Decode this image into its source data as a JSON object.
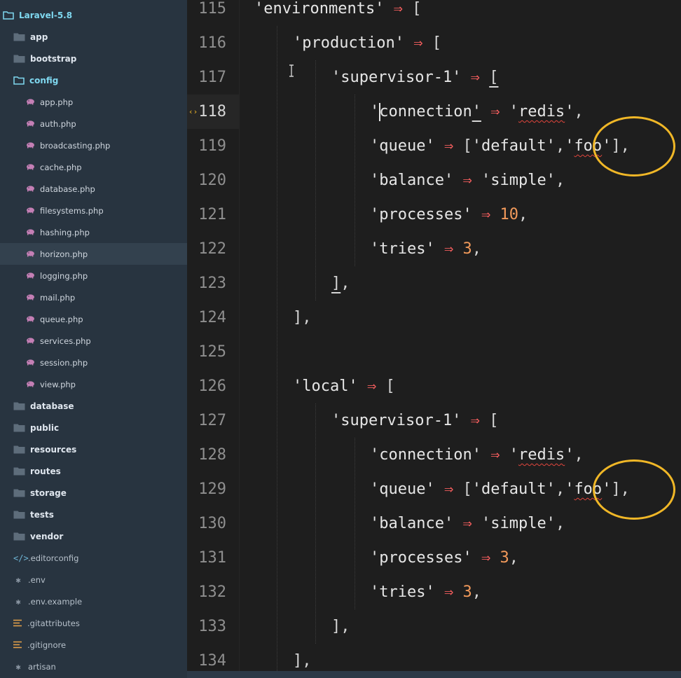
{
  "sidebar": {
    "root": {
      "label": "Laravel-5.8"
    },
    "items": [
      {
        "label": "app",
        "kind": "folder"
      },
      {
        "label": "bootstrap",
        "kind": "folder"
      },
      {
        "label": "config",
        "kind": "folder-open"
      },
      {
        "label": "app.php",
        "kind": "php"
      },
      {
        "label": "auth.php",
        "kind": "php"
      },
      {
        "label": "broadcasting.php",
        "kind": "php"
      },
      {
        "label": "cache.php",
        "kind": "php"
      },
      {
        "label": "database.php",
        "kind": "php"
      },
      {
        "label": "filesystems.php",
        "kind": "php"
      },
      {
        "label": "hashing.php",
        "kind": "php"
      },
      {
        "label": "horizon.php",
        "kind": "php",
        "selected": true
      },
      {
        "label": "logging.php",
        "kind": "php"
      },
      {
        "label": "mail.php",
        "kind": "php"
      },
      {
        "label": "queue.php",
        "kind": "php"
      },
      {
        "label": "services.php",
        "kind": "php"
      },
      {
        "label": "session.php",
        "kind": "php"
      },
      {
        "label": "view.php",
        "kind": "php"
      },
      {
        "label": "database",
        "kind": "folder"
      },
      {
        "label": "public",
        "kind": "folder"
      },
      {
        "label": "resources",
        "kind": "folder"
      },
      {
        "label": "routes",
        "kind": "folder"
      },
      {
        "label": "storage",
        "kind": "folder"
      },
      {
        "label": "tests",
        "kind": "folder"
      },
      {
        "label": "vendor",
        "kind": "folder"
      },
      {
        "label": ".editorconfig",
        "kind": "code-file"
      },
      {
        "label": ".env",
        "kind": "star-file"
      },
      {
        "label": ".env.example",
        "kind": "star-file"
      },
      {
        "label": ".gitattributes",
        "kind": "lines-file"
      },
      {
        "label": ".gitignore",
        "kind": "lines-file"
      },
      {
        "label": "artisan",
        "kind": "star-file"
      }
    ]
  },
  "editor": {
    "current_line": "118",
    "lines": [
      {
        "n": "115",
        "indent": 2,
        "tokens": [
          [
            "str",
            "'environments'"
          ],
          [
            "op",
            " ⇒ "
          ],
          [
            "pun",
            "["
          ]
        ]
      },
      {
        "n": "116",
        "indent": 3,
        "tokens": [
          [
            "str",
            "'production'"
          ],
          [
            "op",
            " ⇒ "
          ],
          [
            "pun",
            "["
          ]
        ]
      },
      {
        "n": "117",
        "indent": 4,
        "tokens": [
          [
            "str",
            "'supervisor-1'"
          ],
          [
            "op",
            " ⇒ "
          ],
          [
            "pun",
            "[",
            "under"
          ]
        ]
      },
      {
        "n": "118",
        "indent": 5,
        "tokens": [
          [
            "str",
            "'connection"
          ],
          [
            "str",
            "'",
            "under"
          ],
          [
            "op",
            " ⇒ "
          ],
          [
            "str",
            "'"
          ],
          [
            "str",
            "redis",
            "squig"
          ],
          [
            "str",
            "'"
          ],
          [
            "pun",
            ","
          ]
        ]
      },
      {
        "n": "119",
        "indent": 5,
        "tokens": [
          [
            "str",
            "'queue'"
          ],
          [
            "op",
            " ⇒ "
          ],
          [
            "pun",
            "["
          ],
          [
            "str",
            "'default'"
          ],
          [
            "pun",
            ","
          ],
          [
            "str",
            "'"
          ],
          [
            "str",
            "foo",
            "squig"
          ],
          [
            "str",
            "'"
          ],
          [
            "pun",
            "],"
          ]
        ]
      },
      {
        "n": "120",
        "indent": 5,
        "tokens": [
          [
            "str",
            "'balance'"
          ],
          [
            "op",
            " ⇒ "
          ],
          [
            "str",
            "'simple'"
          ],
          [
            "pun",
            ","
          ]
        ]
      },
      {
        "n": "121",
        "indent": 5,
        "tokens": [
          [
            "str",
            "'processes'"
          ],
          [
            "op",
            " ⇒ "
          ],
          [
            "num",
            "10"
          ],
          [
            "pun",
            ","
          ]
        ]
      },
      {
        "n": "122",
        "indent": 5,
        "tokens": [
          [
            "str",
            "'tries'"
          ],
          [
            "op",
            " ⇒ "
          ],
          [
            "num",
            "3"
          ],
          [
            "pun",
            ","
          ]
        ]
      },
      {
        "n": "123",
        "indent": 4,
        "tokens": [
          [
            "pun",
            "]",
            "under"
          ],
          [
            "pun",
            ","
          ]
        ]
      },
      {
        "n": "124",
        "indent": 3,
        "tokens": [
          [
            "pun",
            "],"
          ]
        ]
      },
      {
        "n": "125",
        "indent": 0,
        "tokens": []
      },
      {
        "n": "126",
        "indent": 3,
        "tokens": [
          [
            "str",
            "'local'"
          ],
          [
            "op",
            " ⇒ "
          ],
          [
            "pun",
            "["
          ]
        ]
      },
      {
        "n": "127",
        "indent": 4,
        "tokens": [
          [
            "str",
            "'supervisor-1'"
          ],
          [
            "op",
            " ⇒ "
          ],
          [
            "pun",
            "["
          ]
        ]
      },
      {
        "n": "128",
        "indent": 5,
        "tokens": [
          [
            "str",
            "'connection'"
          ],
          [
            "op",
            " ⇒ "
          ],
          [
            "str",
            "'"
          ],
          [
            "str",
            "redis",
            "squig"
          ],
          [
            "str",
            "'"
          ],
          [
            "pun",
            ","
          ]
        ]
      },
      {
        "n": "129",
        "indent": 5,
        "tokens": [
          [
            "str",
            "'queue'"
          ],
          [
            "op",
            " ⇒ "
          ],
          [
            "pun",
            "["
          ],
          [
            "str",
            "'default'"
          ],
          [
            "pun",
            ","
          ],
          [
            "str",
            "'"
          ],
          [
            "str",
            "foo",
            "squig"
          ],
          [
            "str",
            "'"
          ],
          [
            "pun",
            "],"
          ]
        ]
      },
      {
        "n": "130",
        "indent": 5,
        "tokens": [
          [
            "str",
            "'balance'"
          ],
          [
            "op",
            " ⇒ "
          ],
          [
            "str",
            "'simple'"
          ],
          [
            "pun",
            ","
          ]
        ]
      },
      {
        "n": "131",
        "indent": 5,
        "tokens": [
          [
            "str",
            "'processes'"
          ],
          [
            "op",
            " ⇒ "
          ],
          [
            "num",
            "3"
          ],
          [
            "pun",
            ","
          ]
        ]
      },
      {
        "n": "132",
        "indent": 5,
        "tokens": [
          [
            "str",
            "'tries'"
          ],
          [
            "op",
            " ⇒ "
          ],
          [
            "num",
            "3"
          ],
          [
            "pun",
            ","
          ]
        ]
      },
      {
        "n": "133",
        "indent": 4,
        "tokens": [
          [
            "pun",
            "],"
          ]
        ]
      },
      {
        "n": "134",
        "indent": 3,
        "tokens": [
          [
            "pun",
            "],"
          ]
        ]
      }
    ]
  },
  "colors": {
    "sidebar_bg": "#283440",
    "editor_bg": "#1e1e1e",
    "operator": "#f25d5d",
    "number": "#f29a5b",
    "highlight_circle": "#f0b727",
    "folder_open": "#7fd8f0",
    "php_icon": "#c47fb5"
  }
}
